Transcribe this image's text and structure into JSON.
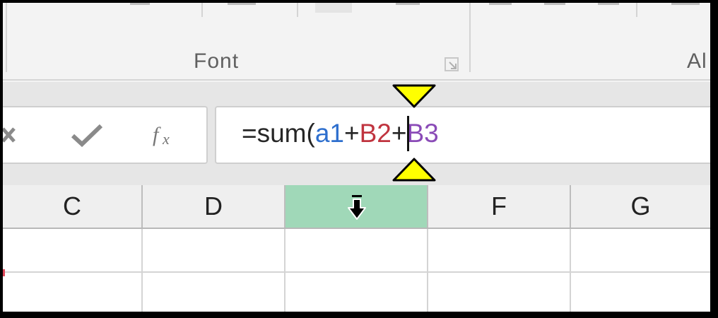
{
  "ribbon": {
    "groups": [
      {
        "label": "Font"
      },
      {
        "label": "Al"
      }
    ]
  },
  "icons": {
    "cancel": "close-x-icon",
    "enter": "checkmark-icon",
    "insert_function": "fx-icon",
    "dialog_launcher": "dialog-launcher-icon",
    "column_select_cursor": "down-arrow-cursor-icon",
    "touch_handles": "yellow-triangle-handle-icon"
  },
  "formula_bar": {
    "prefix": "=sum(",
    "ref1": "a1",
    "plus1": "+",
    "ref2": "B2",
    "plus2": "+",
    "ref3": "B3",
    "ref_colors": {
      "ref1": "#2e6fce",
      "ref2": "#c0343f",
      "ref3": "#8a4bb7"
    }
  },
  "columns": [
    {
      "label": "C"
    },
    {
      "label": "D"
    },
    {
      "label": ""
    },
    {
      "label": "F"
    },
    {
      "label": "G"
    }
  ],
  "selected_column_color": "#a0d8b8"
}
